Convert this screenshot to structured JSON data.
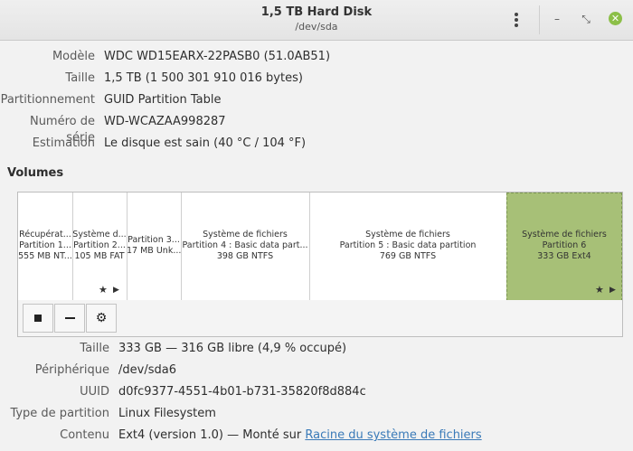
{
  "window": {
    "title": "1,5 TB Hard Disk",
    "subtitle": "/dev/sda"
  },
  "disk_info": [
    {
      "label": "Modèle",
      "value": "WDC WD15EARX-22PASB0 (51.0AB51)"
    },
    {
      "label": "Taille",
      "value": "1,5 TB (1 500 301 910 016 bytes)"
    },
    {
      "label": "Partitionnement",
      "value": "GUID Partition Table"
    },
    {
      "label": "Numéro de série",
      "value": "WD-WCAZAA998287"
    },
    {
      "label": "Estimation",
      "value": "Le disque est sain (40 °C / 104 °F)"
    }
  ],
  "volumes_heading": "Volumes",
  "volumes": [
    {
      "line1": "Récupérat...",
      "line2": "Partition 1...",
      "line3": "555 MB NT..."
    },
    {
      "line1": "Système d...",
      "line2": "Partition 2...",
      "line3": "105 MB FAT"
    },
    {
      "line1": "Partition 3...",
      "line2": "17 MB Unk..."
    },
    {
      "line1": "Système de fichiers",
      "line2": "Partition 4 : Basic data part...",
      "line3": "398 GB NTFS"
    },
    {
      "line1": "Système de fichiers",
      "line2": "Partition 5 : Basic data partition",
      "line3": "769 GB NTFS"
    },
    {
      "line1": "Système de fichiers",
      "line2": "Partition 6",
      "line3": "333 GB Ext4"
    }
  ],
  "volume_details": [
    {
      "label": "Taille",
      "value": "333 GB — 316 GB libre (4,9 % occupé)"
    },
    {
      "label": "Périphérique",
      "value": "/dev/sda6"
    },
    {
      "label": "UUID",
      "value": "d0fc9377-4551-4b01-b731-35820f8d884c"
    },
    {
      "label": "Type de partition",
      "value": "Linux Filesystem"
    },
    {
      "label": "Contenu",
      "value": "Ext4 (version 1.0) — Monté sur ",
      "link": "Racine du système de fichiers"
    }
  ],
  "colors": {
    "accent_selected": "#a7c077",
    "close_button": "#8cbf48",
    "link": "#3a7ab8"
  },
  "icons": {
    "menu": "vertical-dots-icon",
    "minimize": "minimize-icon",
    "maximize": "maximize-icon",
    "close": "close-icon",
    "stop": "stop-icon",
    "remove": "minus-icon",
    "settings": "gear-icon",
    "mounted": "star-icon",
    "play": "play-icon"
  }
}
